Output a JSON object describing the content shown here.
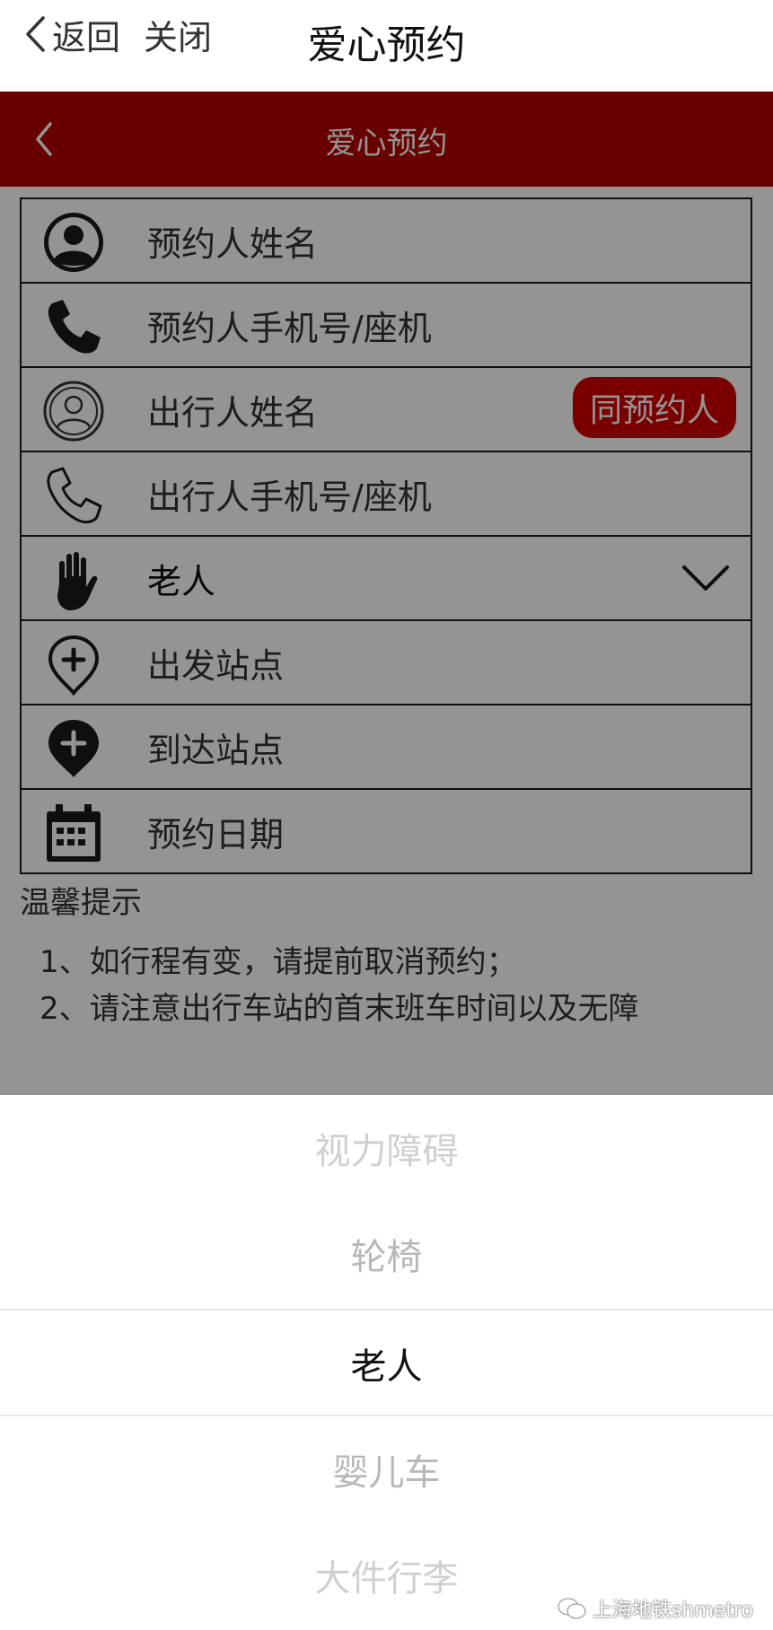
{
  "nav": {
    "back": "返回",
    "close": "关闭",
    "title": "爱心预约"
  },
  "header": {
    "title": "爱心预约"
  },
  "form": {
    "booker_name": "预约人姓名",
    "booker_phone": "预约人手机号/座机",
    "traveler_name": "出行人姓名",
    "same_as_booker": "同预约人",
    "traveler_phone": "出行人手机号/座机",
    "passenger_type": "老人",
    "departure": "出发站点",
    "arrival": "到达站点",
    "date": "预约日期"
  },
  "tips": {
    "title": "温馨提示",
    "line1": "1、如行程有变，请提前取消预约；",
    "line2": "2、请注意出行车站的首末班车时间以及无障"
  },
  "picker": {
    "options": [
      "视力障碍",
      "轮椅",
      "老人",
      "婴儿车",
      "大件行李"
    ],
    "selected": "老人"
  },
  "watermark": "上海地铁shmetro",
  "colors": {
    "brand_red": "#b30000",
    "button_red": "#d20000"
  },
  "icons": [
    "back-chevron-icon",
    "person-icon",
    "phone-icon",
    "person-outline-icon",
    "phone-outline-icon",
    "hand-icon",
    "chevron-down-icon",
    "location-plus-outline-icon",
    "location-plus-icon",
    "calendar-icon",
    "wechat-icon"
  ]
}
